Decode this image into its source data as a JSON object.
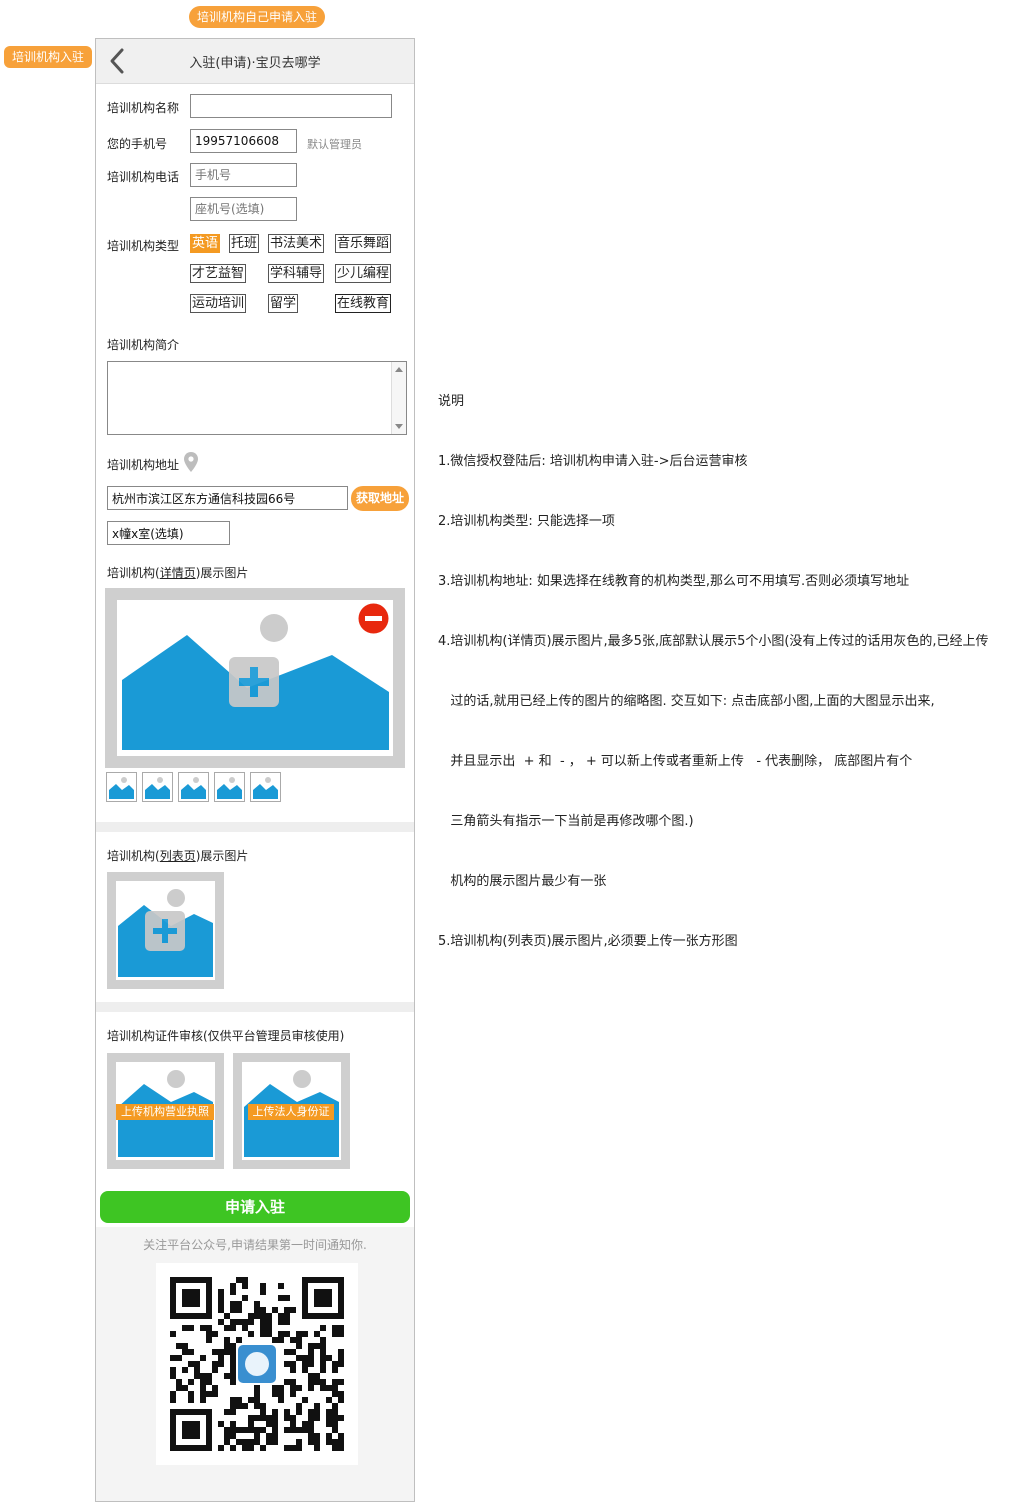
{
  "annotations": {
    "top_tag": "培训机构自己申请入驻",
    "left_tag": "培训机构入驻"
  },
  "nav": {
    "title": "入驻(申请)·宝贝去哪学"
  },
  "form": {
    "name_label": "培训机构名称",
    "name_value": "",
    "phone_label": "您的手机号",
    "phone_value": "19957106608",
    "phone_hint": "默认管理员",
    "tel_label": "培训机构电话",
    "mobile_placeholder": "手机号",
    "landline_placeholder": "座机号(选填)",
    "type_label": "培训机构类型",
    "types": [
      {
        "label": "英语",
        "selected": true
      },
      {
        "label": "托班",
        "selected": false
      },
      {
        "label": "书法美术",
        "selected": false
      },
      {
        "label": "音乐舞蹈",
        "selected": false
      },
      {
        "label": "才艺益智",
        "selected": false
      },
      {
        "label": "学科辅导",
        "selected": false
      },
      {
        "label": "少儿编程",
        "selected": false
      },
      {
        "label": "运动培训",
        "selected": false
      },
      {
        "label": "留学",
        "selected": false
      },
      {
        "label": "在线教育",
        "selected": false
      }
    ],
    "intro_label": "培训机构简介",
    "address_label": "培训机构地址",
    "address_value": "杭州市滨江区东方通信科技园66号",
    "get_address_button": "获取地址",
    "room_value": "x幢x室(选填)",
    "detail_images_label_prefix": "培训机构(",
    "detail_images_label_link": "详情页",
    "detail_images_label_suffix": ")展示图片",
    "list_images_label_prefix": "培训机构(",
    "list_images_label_link": "列表页",
    "list_images_label_suffix": ")展示图片",
    "cert_label": "培训机构证件审核(仅供平台管理员审核使用)",
    "upload_license": "上传机构营业执照",
    "upload_id": "上传法人身份证",
    "submit_button": "申请入驻",
    "follow_text": "关注平台公众号,申请结果第一时间通知你."
  },
  "colors": {
    "orange": "#f7a13a",
    "green": "#3ec523",
    "blue": "#1a9ad6",
    "red": "#e8280e"
  },
  "notes": {
    "lines": [
      "说明",
      "1.微信授权登陆后: 培训机构申请入驻->后台运营审核",
      "2.培训机构类型: 只能选择一项",
      "3.培训机构地址: 如果选择在线教育的机构类型,那么可不用填写.否则必须填写地址",
      "4.培训机构(详情页)展示图片,最多5张,底部默认展示5个小图(没有上传过的话用灰色的,已经上传",
      "   过的话,就用已经上传的图片的缩略图. 交互如下: 点击底部小图,上面的大图显示出来,",
      "   并且显示出  + 和  - ， + 可以新上传或者重新上传   - 代表删除， 底部图片有个",
      "   三角箭头有指示一下当前是再修改哪个图.)",
      "   机构的展示图片最少有一张",
      "5.培训机构(列表页)展示图片,必须要上传一张方形图"
    ]
  }
}
